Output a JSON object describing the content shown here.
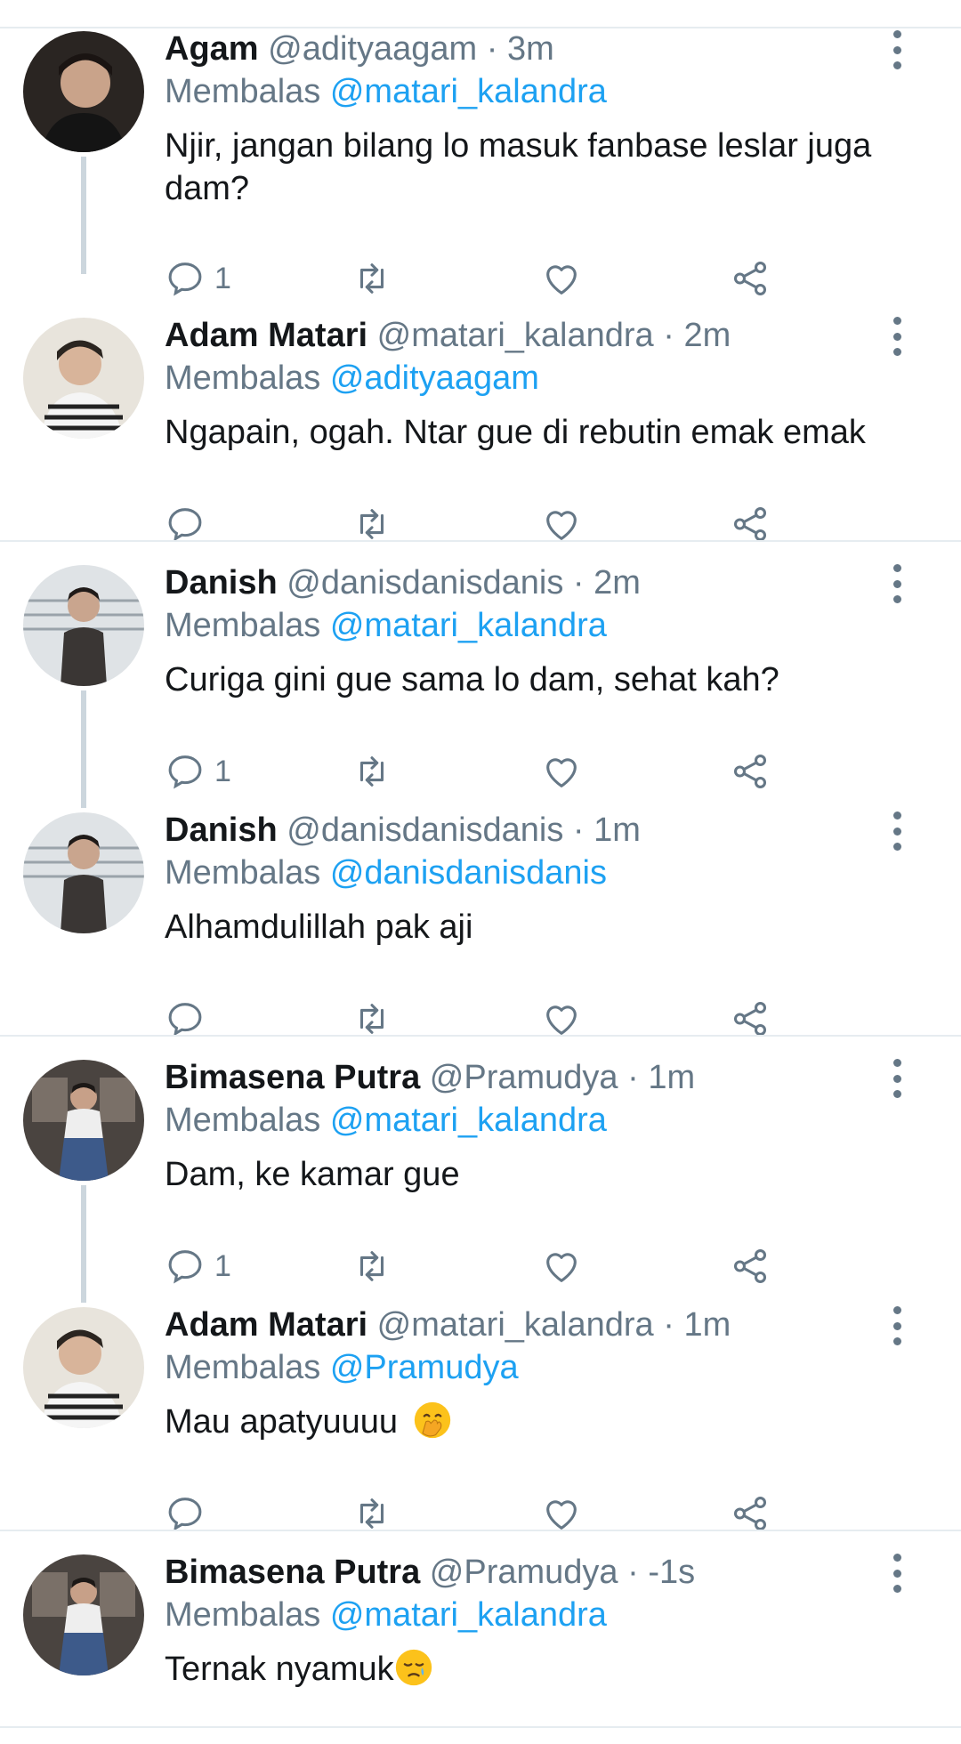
{
  "tweets": [
    {
      "name": "Agam",
      "handle": "@adityaagam",
      "sep": " · ",
      "time": "3m",
      "reply_label": "Membalas ",
      "reply_to": "@matari_kalandra",
      "text": "Njir, jangan bilang lo masuk fanbase leslar juga dam?",
      "reply_count": "1",
      "avatar": "avatar-agam"
    },
    {
      "name": "Adam Matari",
      "handle": "@matari_kalandra",
      "sep": " · ",
      "time": "2m",
      "reply_label": "Membalas ",
      "reply_to": "@adityaagam",
      "text": "Ngapain, ogah. Ntar gue di rebutin emak emak",
      "reply_count": "",
      "avatar": "avatar-adam"
    },
    {
      "name": "Danish",
      "handle": "@danisdanisdanis",
      "sep": " · ",
      "time": "2m",
      "reply_label": "Membalas ",
      "reply_to": "@matari_kalandra",
      "text": "Curiga gini gue sama lo dam, sehat kah?",
      "reply_count": "1",
      "avatar": "avatar-danish"
    },
    {
      "name": "Danish",
      "handle": "@danisdanisdanis",
      "sep": " · ",
      "time": "1m",
      "reply_label": "Membalas ",
      "reply_to": "@danisdanisdanis",
      "text": "Alhamdulillah pak aji",
      "reply_count": "",
      "avatar": "avatar-danish"
    },
    {
      "name": "Bimasena Putra",
      "handle": "@Pramudya",
      "sep": " · ",
      "time": "1m",
      "reply_label": "Membalas ",
      "reply_to": "@matari_kalandra",
      "text": "Dam, ke kamar gue",
      "reply_count": "1",
      "avatar": "avatar-bimasena"
    },
    {
      "name": "Adam Matari",
      "handle": "@matari_kalandra",
      "sep": " · ",
      "time": "1m",
      "reply_label": "Membalas ",
      "reply_to": "@Pramudya",
      "text": "Mau apatyuuuu ",
      "reply_count": "",
      "avatar": "avatar-adam",
      "emoji": "hand-over-mouth-emoji"
    },
    {
      "name": "Bimasena Putra",
      "handle": "@Pramudya",
      "sep": " · ",
      "time": "-1s",
      "reply_label": "Membalas ",
      "reply_to": "@matari_kalandra",
      "text": "Ternak nyamuk",
      "reply_count": "",
      "avatar": "avatar-bimasena",
      "emoji": "sleepy-face-emoji"
    }
  ],
  "colors": {
    "link": "#1da1f2",
    "secondary": "#657786",
    "divider": "#e6ecf0",
    "thread_line": "#ccd6dd"
  }
}
